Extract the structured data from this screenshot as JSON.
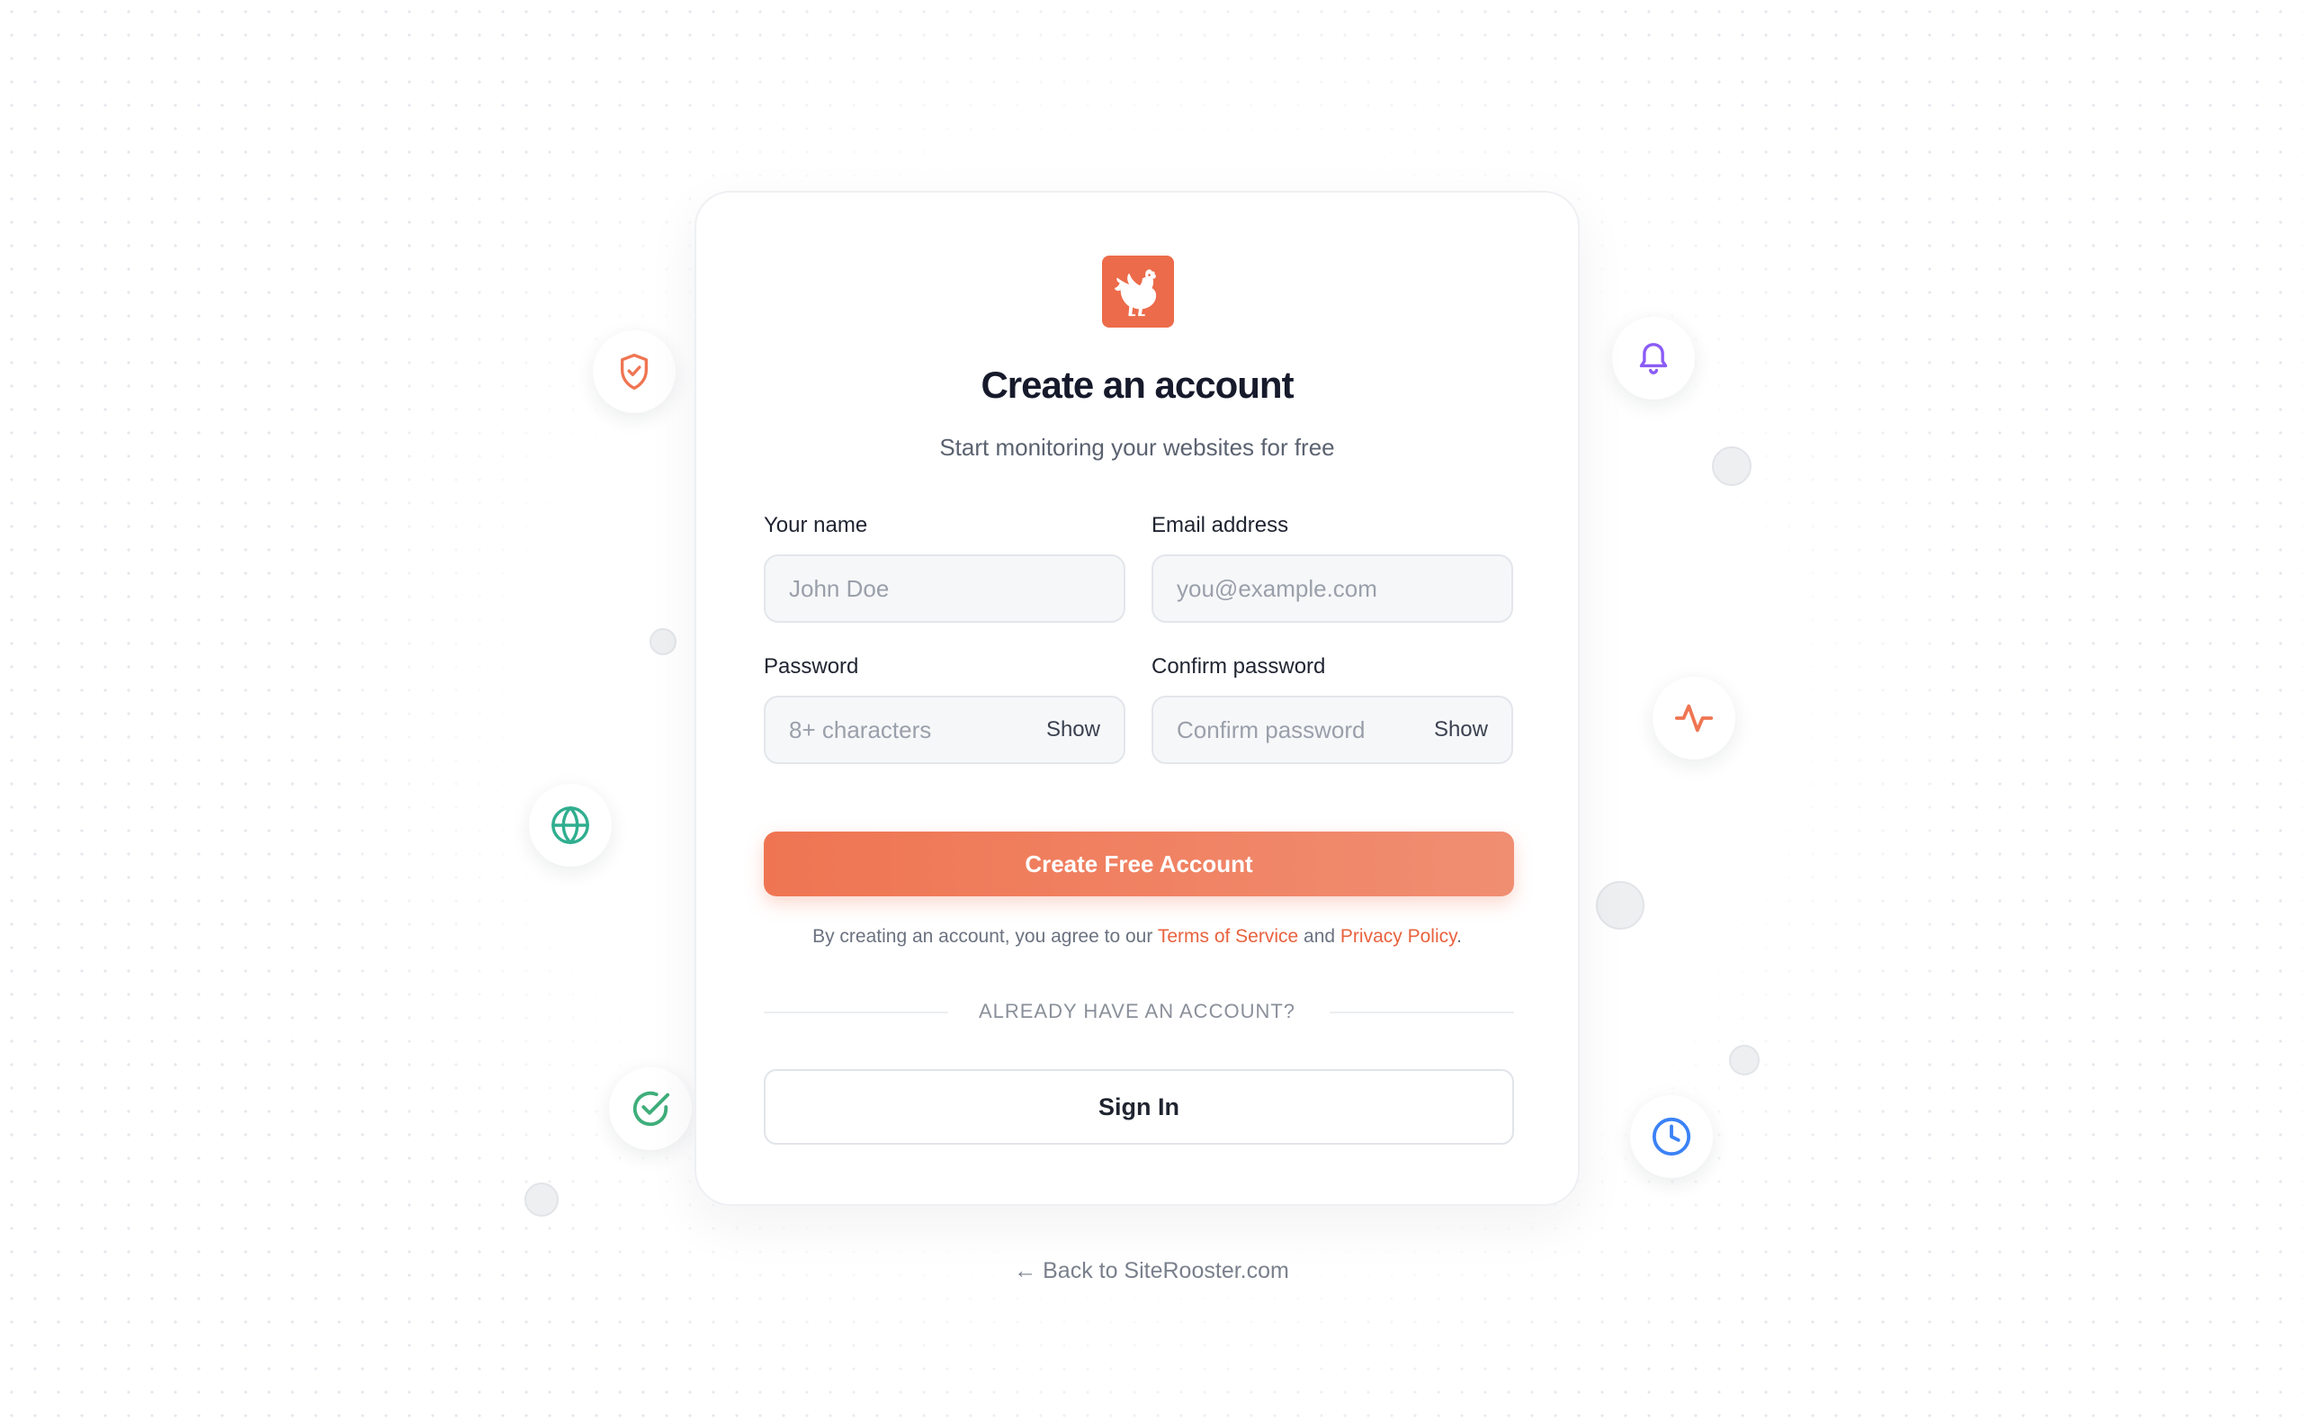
{
  "app": {
    "brand_color": "#ec6b4a",
    "logo_icon": "rooster-logo-icon"
  },
  "header": {
    "title": "Create an account",
    "subtitle": "Start monitoring your websites for free"
  },
  "form": {
    "name": {
      "label": "Your name",
      "placeholder": "John Doe",
      "value": ""
    },
    "email": {
      "label": "Email address",
      "placeholder": "you@example.com",
      "value": ""
    },
    "password": {
      "label": "Password",
      "placeholder": "8+ characters",
      "value": "",
      "toggle_label": "Show"
    },
    "confirm": {
      "label": "Confirm password",
      "placeholder": "Confirm password",
      "value": "",
      "toggle_label": "Show"
    },
    "submit_label": "Create Free Account"
  },
  "terms": {
    "prefix": "By creating an account, you agree to our",
    "tos_link": "Terms of Service",
    "and": "and",
    "privacy_link": "Privacy Policy",
    "suffix": "."
  },
  "divider": {
    "text": "ALREADY HAVE AN ACCOUNT?"
  },
  "signin": {
    "label": "Sign In"
  },
  "footer": {
    "back_arrow": "←",
    "back_label": "Back to SiteRooster.com"
  },
  "decorations": {
    "icons": [
      "shield-check-icon",
      "bell-icon",
      "globe-icon",
      "activity-icon",
      "check-circle-icon",
      "clock-icon"
    ]
  }
}
